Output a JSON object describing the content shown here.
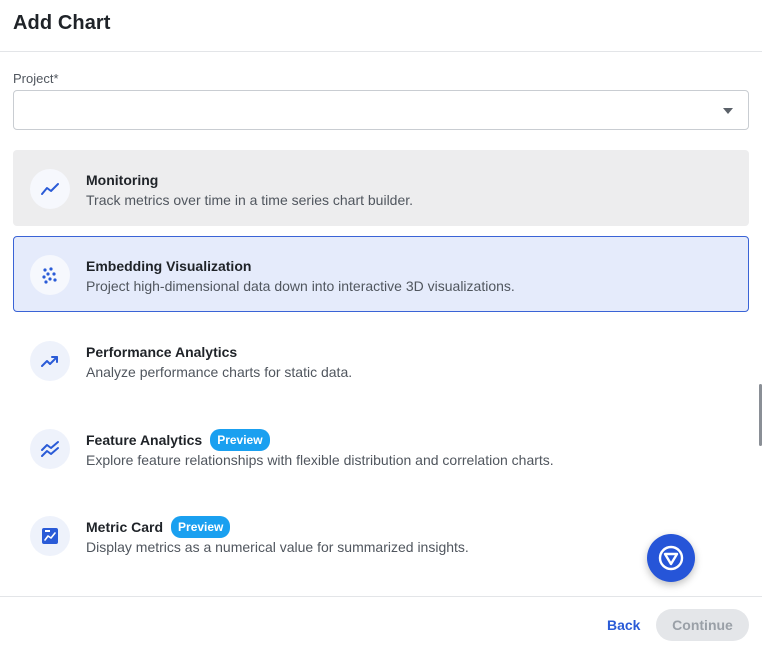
{
  "dialog": {
    "title": "Add Chart"
  },
  "project": {
    "label": "Project*",
    "value": ""
  },
  "options": [
    {
      "title": "Monitoring",
      "badge": "",
      "description": "Track metrics over time in a time series chart builder.",
      "icon": "line-trend-icon",
      "state": "hover"
    },
    {
      "title": "Embedding Visualization",
      "badge": "",
      "description": "Project high-dimensional data down into interactive 3D visualizations.",
      "icon": "scatter-dots-icon",
      "state": "selected"
    },
    {
      "title": "Performance Analytics",
      "badge": "",
      "description": "Analyze performance charts for static data.",
      "icon": "trending-up-icon",
      "state": "default"
    },
    {
      "title": "Feature Analytics",
      "badge": "Preview",
      "description": "Explore feature relationships with flexible distribution and correlation charts.",
      "icon": "multi-line-icon",
      "state": "default"
    },
    {
      "title": "Metric Card",
      "badge": "Preview",
      "description": "Display metrics as a numerical value for summarized insights.",
      "icon": "metric-card-icon",
      "state": "default"
    }
  ],
  "footer": {
    "back_label": "Back",
    "continue_label": "Continue"
  },
  "colors": {
    "accent": "#2a5bd7",
    "selected_bg": "#e5ebfb",
    "badge": "#1aa0f0",
    "fab": "#2655d8"
  }
}
